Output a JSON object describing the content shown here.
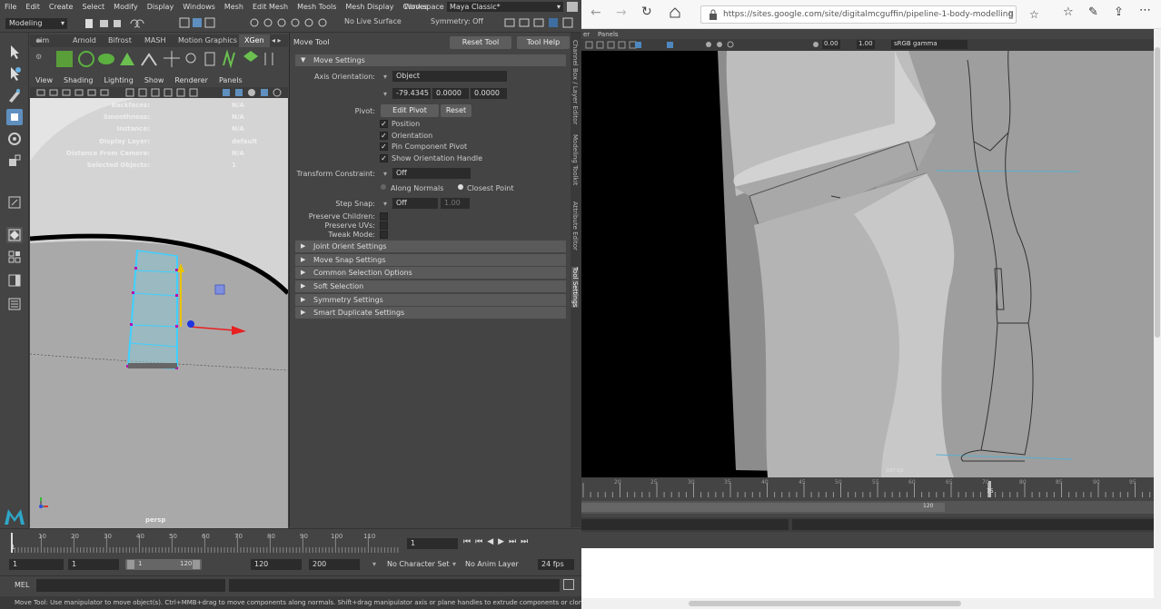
{
  "maya": {
    "menus": [
      "File",
      "Edit",
      "Create",
      "Select",
      "Modify",
      "Display",
      "Windows",
      "Mesh",
      "Edit Mesh",
      "Mesh Tools",
      "Mesh Display",
      "Curves"
    ],
    "workspace_label": "Workspace :",
    "workspace_value": "Maya Classic*",
    "menuset": "Modeling",
    "live_surface": "No Live Surface",
    "symmetry": "Symmetry: Off",
    "shelf_tabs": [
      "sim",
      "Arnold",
      "Bifrost",
      "MASH",
      "Motion Graphics",
      "XGen"
    ],
    "viewport_menus": [
      "View",
      "Shading",
      "Lighting",
      "Show",
      "Renderer",
      "Panels"
    ],
    "hud": [
      {
        "k": "Backfaces:",
        "v": "N/A"
      },
      {
        "k": "Smoothness:",
        "v": "N/A"
      },
      {
        "k": "Instance:",
        "v": "N/A"
      },
      {
        "k": "Display Layer:",
        "v": "default"
      },
      {
        "k": "Distance From Camera:",
        "v": "N/A"
      },
      {
        "k": "Selected Objects:",
        "v": "1"
      }
    ],
    "camera_label": "persp",
    "tool_settings": {
      "title": "Move Tool",
      "reset_tool": "Reset Tool",
      "tool_help": "Tool Help",
      "move_settings": "Move Settings",
      "axis_orientation_label": "Axis Orientation:",
      "axis_orientation_value": "Object",
      "xyz": [
        "-79.4345",
        "0.0000",
        "0.0000"
      ],
      "pivot_label": "Pivot:",
      "edit_pivot": "Edit Pivot",
      "reset": "Reset",
      "checks": [
        {
          "label": "Position",
          "checked": true
        },
        {
          "label": "Orientation",
          "checked": true
        },
        {
          "label": "Pin Component Pivot",
          "checked": true
        },
        {
          "label": "Show Orientation Handle",
          "checked": true
        }
      ],
      "transform_constraint_label": "Transform Constraint:",
      "transform_constraint_value": "Off",
      "along_normals": "Along Normals",
      "closest_point": "Closest Point",
      "step_snap_label": "Step Snap:",
      "step_snap_value": "Off",
      "step_snap_amount": "1.00",
      "preserve_children": "Preserve Children:",
      "preserve_uvs": "Preserve UVs:",
      "tweak_mode": "Tweak Mode:",
      "sections": [
        "Joint Orient Settings",
        "Move Snap Settings",
        "Common Selection Options",
        "Soft Selection",
        "Symmetry Settings",
        "Smart Duplicate Settings"
      ]
    },
    "side_tabs": [
      "Channel Box / Layer Editor",
      "Modeling Toolkit",
      "Attribute Editor",
      "Tool Settings"
    ],
    "timeline_ticks": [
      "10",
      "20",
      "30",
      "40",
      "50",
      "60",
      "70",
      "80",
      "90",
      "100",
      "110"
    ],
    "timeline_start": "1",
    "current_frame": "1",
    "range": {
      "start": "1",
      "playback_start": "1",
      "slider_start": "1",
      "slider_end": "120",
      "playback_end": "120",
      "end": "200"
    },
    "character_set": "No Character Set",
    "anim_layer": "No Anim Layer",
    "fps": "24 fps",
    "cmd_label": "MEL",
    "help_text": "Move Tool: Use manipulator to move object(s). Ctrl+MMB+drag to move components along normals. Shift+drag manipulator axis or plane handles to extrude components or clone objects. Ctrl+Shift+LMB+drag"
  },
  "browser": {
    "url": "https://sites.google.com/site/digitalmcguffin/pipeline-1-body-modelling",
    "panel_menus": [
      "er",
      "Panels"
    ],
    "field_a": "0.00",
    "field_b": "1.00",
    "color_space": "sRGB gamma",
    "camera_label": "persp",
    "ticks": [
      "20",
      "25",
      "30",
      "35",
      "40",
      "45",
      "50",
      "55",
      "60",
      "65",
      "70",
      "75",
      "80",
      "85",
      "90",
      "95"
    ],
    "current_tick": "75",
    "range_end": "120"
  }
}
